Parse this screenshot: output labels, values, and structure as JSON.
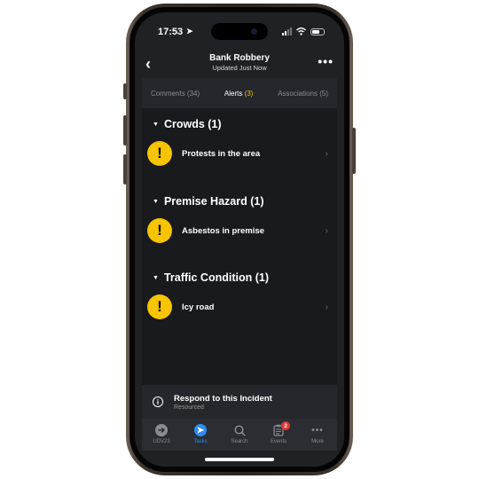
{
  "status_bar": {
    "time": "17:53"
  },
  "header": {
    "title": "Bank Robbery",
    "subtitle": "Updated Just Now",
    "back_glyph": "‹",
    "more_glyph": "•••"
  },
  "tabs": [
    {
      "label": "Comments",
      "count": "(34)"
    },
    {
      "label": "Alerts",
      "count": "(3)"
    },
    {
      "label": "Associations",
      "count": "(5)"
    }
  ],
  "sections": [
    {
      "title": "Crowds (1)",
      "alerts": [
        {
          "label": "Protests in the area"
        }
      ]
    },
    {
      "title": "Premise Hazard (1)",
      "alerts": [
        {
          "label": "Asbestos in premise"
        }
      ]
    },
    {
      "title": "Traffic Condition (1)",
      "alerts": [
        {
          "label": "Icy road"
        }
      ]
    }
  ],
  "respond": {
    "title": "Respond to this Incident",
    "subtitle": "Resourced"
  },
  "tab_bar": [
    {
      "label": "UDV23",
      "icon": "arrow-right-circle-icon"
    },
    {
      "label": "Tasks",
      "icon": "location-arrow-icon"
    },
    {
      "label": "Search",
      "icon": "search-icon"
    },
    {
      "label": "Events",
      "icon": "clipboard-icon",
      "badge": "2"
    },
    {
      "label": "More",
      "icon": "more-dots-icon"
    }
  ],
  "colors": {
    "accent_yellow": "#f6c400",
    "active_blue": "#2f8cf0",
    "badge_red": "#e53935",
    "background": "#1f2125"
  }
}
